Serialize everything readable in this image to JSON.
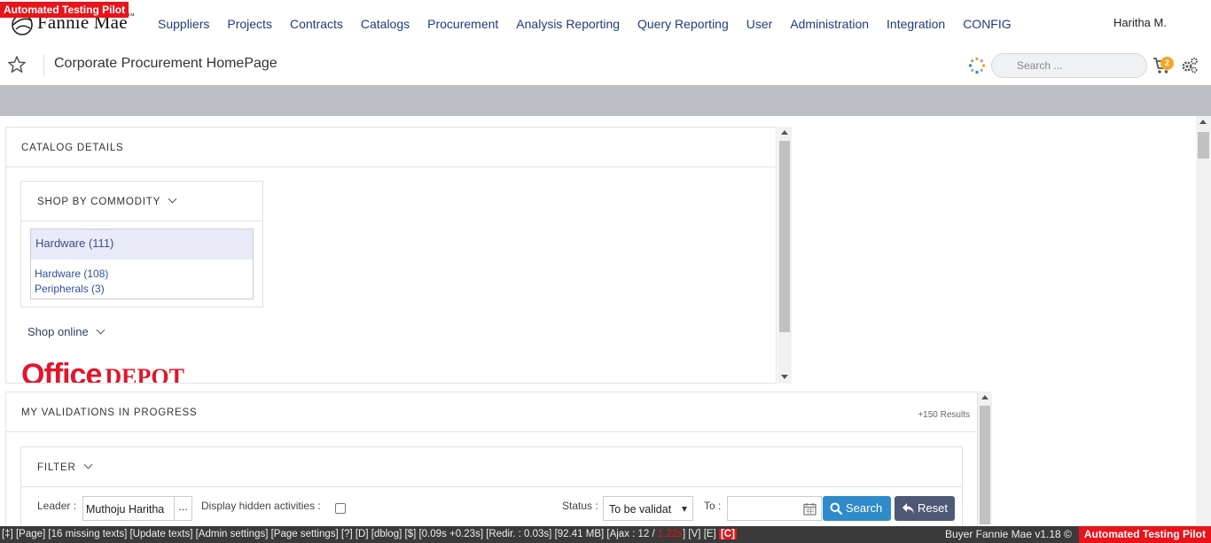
{
  "badge": "Automated Testing Pilot",
  "brand": {
    "name": "Fannie Mae",
    "tm": "™"
  },
  "nav": [
    "Suppliers",
    "Projects",
    "Contracts",
    "Catalogs",
    "Procurement",
    "Analysis Reporting",
    "Query Reporting",
    "User",
    "Administration",
    "Integration",
    "CONFIG"
  ],
  "user": "Haritha M.",
  "page_title": "Corporate Procurement HomePage",
  "search_placeholder": "Search ...",
  "cart_count": "2",
  "catalog": {
    "title": "CATALOG DETAILS",
    "commodity_title": "SHOP BY COMMODITY",
    "selected": "Hardware (111)",
    "items": [
      "Hardware (108)",
      "Peripherals (3)"
    ],
    "shop_online": "Shop online",
    "logo_office": "Office",
    "logo_depot": "DEPOT"
  },
  "validations": {
    "title": "MY VALIDATIONS IN PROGRESS",
    "results": "+150 Results",
    "filter_title": "FILTER",
    "leader_label": "Leader :",
    "leader_value": "Muthoju Haritha",
    "leader_dots": "...",
    "hidden_label": "Display hidden activities :",
    "status_label": "Status :",
    "status_value": "To be validat",
    "to_label": "To :",
    "search_btn": "Search",
    "reset_btn": "Reset"
  },
  "debug": {
    "text": "[‡] [Page] [16 missing texts] [Update texts] [Admin settings] [Page settings] [?] [D] [dblog] [$] [0.09s +0.23s] [Redir. : 0.03s] [92.41 MB] [Ajax : 12 / ",
    "red": "1.22s",
    "tail": "] [V] [E] ",
    "c": "[C]",
    "version": "Buyer Fannie Mae v1.18 ©",
    "badge": "Automated Testing Pilot"
  },
  "colors": {
    "nav_text": "#1f3d7a",
    "badge_red": "#e8141b",
    "search_btn": "#2f8bc9",
    "reset_btn": "#4e5a75",
    "cart_badge": "#f5a623"
  }
}
